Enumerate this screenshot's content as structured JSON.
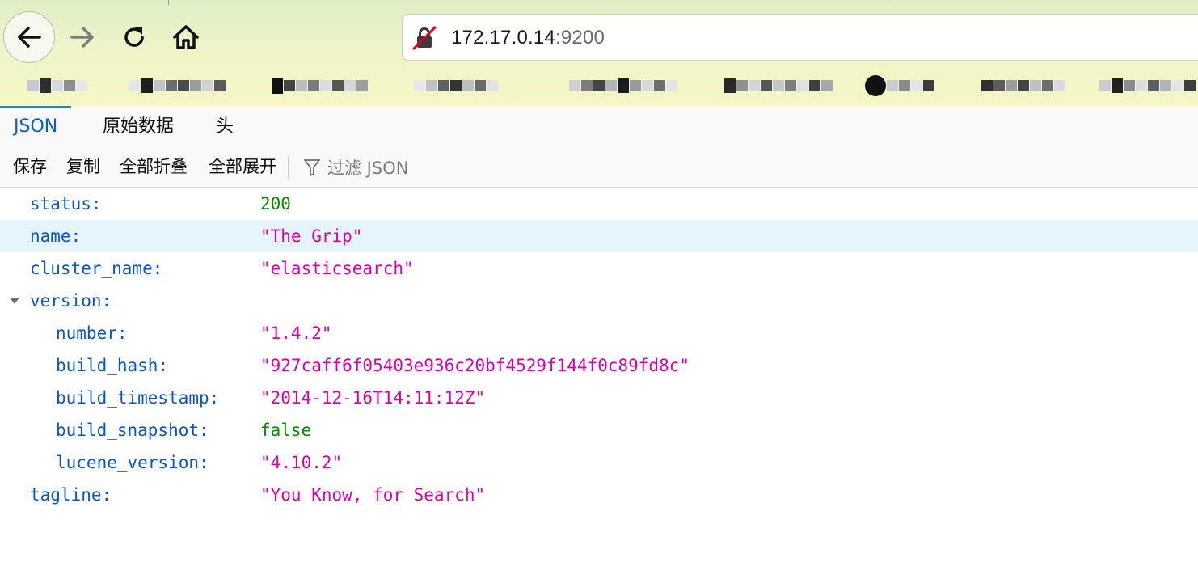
{
  "browser": {
    "url_host": "172.17.0.14",
    "url_port": ":9200",
    "buttons": {
      "back": "back-arrow-icon",
      "forward": "forward-arrow-icon",
      "reload": "reload-icon",
      "home": "home-icon",
      "security": "insecure-lock-icon"
    }
  },
  "viewer": {
    "tabs": [
      {
        "label": "JSON",
        "active": true
      },
      {
        "label": "原始数据",
        "active": false
      },
      {
        "label": "头",
        "active": false
      }
    ],
    "toolbar": {
      "save": "保存",
      "copy": "复制",
      "collapse_all": "全部折叠",
      "expand_all": "全部展开",
      "filter_placeholder": "过滤 JSON"
    },
    "rows": [
      {
        "key": "status:",
        "value": "200"
      },
      {
        "key": "name:",
        "value": "\"The Grip\""
      },
      {
        "key": "cluster_name:",
        "value": "\"elasticsearch\""
      },
      {
        "key": "version:",
        "value": ""
      },
      {
        "key": "number:",
        "value": "\"1.4.2\""
      },
      {
        "key": "build_hash:",
        "value": "\"927caff6f05403e936c20bf4529f144f0c89fd8c\""
      },
      {
        "key": "build_timestamp:",
        "value": "\"2014-12-16T14:11:12Z\""
      },
      {
        "key": "build_snapshot:",
        "value": "false"
      },
      {
        "key": "lucene_version:",
        "value": "\"4.10.2\""
      },
      {
        "key": "tagline:",
        "value": "\"You Know, for Search\""
      }
    ]
  },
  "colors": {
    "key": "#0b56c4",
    "string": "#dd00a9",
    "number_bool": "#058b00",
    "active_tab": "#0a59d6",
    "highlight_row": "#e6f4fb"
  }
}
